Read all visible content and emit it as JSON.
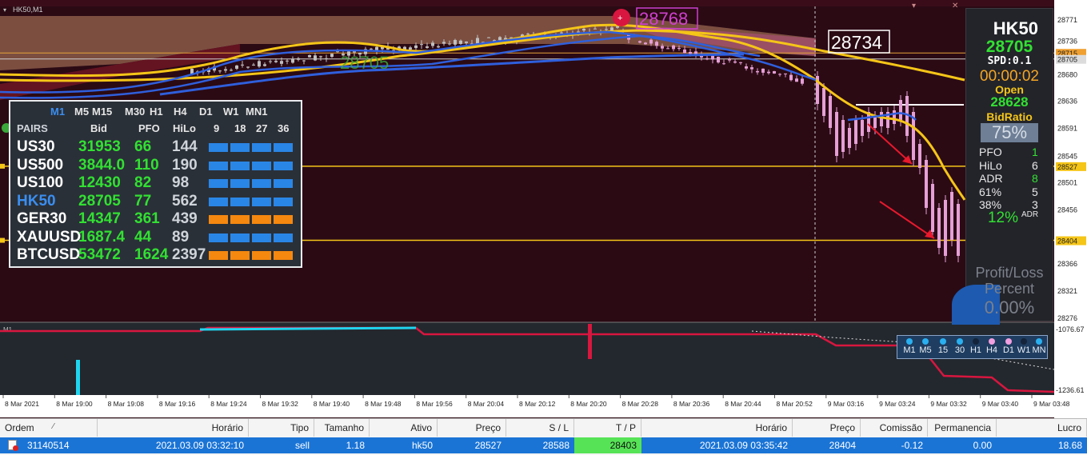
{
  "window": {
    "symbol_label": "HK50,M1"
  },
  "chart": {
    "price_axis_labels": [
      "28771",
      "28736",
      "28715",
      "28705",
      "28680",
      "28636",
      "28591",
      "28545",
      "28527",
      "28501",
      "28456",
      "28404",
      "28366",
      "28321",
      "28276"
    ],
    "highlight_prices": {
      "ask": "28715",
      "bid": "28705",
      "level1": "28527",
      "level2": "28404"
    },
    "annotations": {
      "high_marker": "28768",
      "box_label": "28734",
      "ghost_label": "28705"
    },
    "time_axis_labels": [
      "8 Mar 2021",
      "8 Mar 19:00",
      "8 Mar 19:08",
      "8 Mar 19:16",
      "8 Mar 19:24",
      "8 Mar 19:32",
      "8 Mar 19:40",
      "8 Mar 19:48",
      "8 Mar 19:56",
      "8 Mar 20:04",
      "8 Mar 20:12",
      "8 Mar 20:20",
      "8 Mar 20:28",
      "8 Mar 20:36",
      "8 Mar 20:44",
      "8 Mar 20:52",
      "9 Mar 03:16",
      "9 Mar 03:24",
      "9 Mar 03:32",
      "9 Mar 03:40",
      "9 Mar 03:48"
    ],
    "indicator_label": "M1",
    "indicator_axis": {
      "top": "-1076.67",
      "bottom": "-1236.61"
    },
    "colors": {
      "bg": "#2b0a14",
      "gold": "#f5c518",
      "blue": "#2f5fdc",
      "candle": "#e59fd6",
      "red": "#d8163f",
      "cyan": "#1fd5ef"
    }
  },
  "pairs_table": {
    "timeframes": [
      "M1",
      "M5",
      "M15",
      "M30",
      "H1",
      "H4",
      "D1",
      "W1",
      "MN1"
    ],
    "headers": {
      "pairs": "PAIRS",
      "bid": "Bid",
      "pfo": "PFO",
      "hilo": "HiLo",
      "c1": "9",
      "c2": "18",
      "c3": "27",
      "c4": "36"
    },
    "rows": [
      {
        "pair": "US30",
        "bid": "31953",
        "pfo": "66",
        "hilo": "144",
        "bar_color": "#2a86e6"
      },
      {
        "pair": "US500",
        "bid": "3844.0",
        "pfo": "110",
        "hilo": "190",
        "bar_color": "#2a86e6"
      },
      {
        "pair": "US100",
        "bid": "12430",
        "pfo": "82",
        "hilo": "98",
        "bar_color": "#2a86e6"
      },
      {
        "pair": "HK50",
        "bid": "28705",
        "pfo": "77",
        "hilo": "562",
        "bar_color": "#2a86e6"
      },
      {
        "pair": "GER30",
        "bid": "14347",
        "pfo": "361",
        "hilo": "439",
        "bar_color": "#f5880f"
      },
      {
        "pair": "XAUUSD",
        "bid": "1687.4",
        "pfo": "44",
        "hilo": "89",
        "bar_color": "#2a86e6"
      },
      {
        "pair": "BTCUSD",
        "bid": "53472",
        "pfo": "1624",
        "hilo": "2397",
        "bar_color": "#f5880f"
      }
    ]
  },
  "info_panel": {
    "symbol": "HK50",
    "price": "28705",
    "spread": "SPD:0.1",
    "timer": "00:00:02",
    "open_label": "Open",
    "open_value": "28628",
    "bidratio_label": "BidRatio",
    "bidratio_value": "75%",
    "stats": [
      {
        "label": "PFO",
        "value": "1",
        "color": "#34e234"
      },
      {
        "label": "HiLo",
        "value": "6",
        "color": "#e8e8e8"
      },
      {
        "label": "ADR",
        "value": "8",
        "color": "#34e234"
      },
      {
        "label": "61%",
        "value": "5",
        "color": "#e8e8e8"
      },
      {
        "label": "38%",
        "value": "3",
        "color": "#e8e8e8"
      }
    ],
    "adr_pct": "12%",
    "adr_small": "ADR",
    "pl_title1": "Profit/Loss",
    "pl_title2": "Percent",
    "pl_value": "0.00%"
  },
  "tf_dots": {
    "labels": [
      "M1",
      "M5",
      "15",
      "30",
      "H1",
      "H4",
      "D1",
      "W1",
      "MN"
    ],
    "colors": [
      "#2ab0f0",
      "#2ab0f0",
      "#2ab0f0",
      "#2ab0f0",
      "#15243a",
      "#f0a0e0",
      "#f0a0e0",
      "#15243a",
      "#2ab0f0"
    ]
  },
  "trade_table": {
    "headers": [
      "Ordem",
      "Horário",
      "Tipo",
      "Tamanho",
      "Ativo",
      "Preço",
      "S / L",
      "T / P",
      "Horário",
      "Preço",
      "Comissão",
      "Permanencia",
      "Lucro"
    ],
    "row": {
      "order": "31140514",
      "open_time": "2021.03.09 03:32:10",
      "type": "sell",
      "size": "1.18",
      "asset": "hk50",
      "price": "28527",
      "sl": "28588",
      "tp": "28403",
      "close_time": "2021.03.09 03:35:42",
      "close_price": "28404",
      "commission": "-0.12",
      "duration": "0.00",
      "profit": "18.68"
    }
  }
}
